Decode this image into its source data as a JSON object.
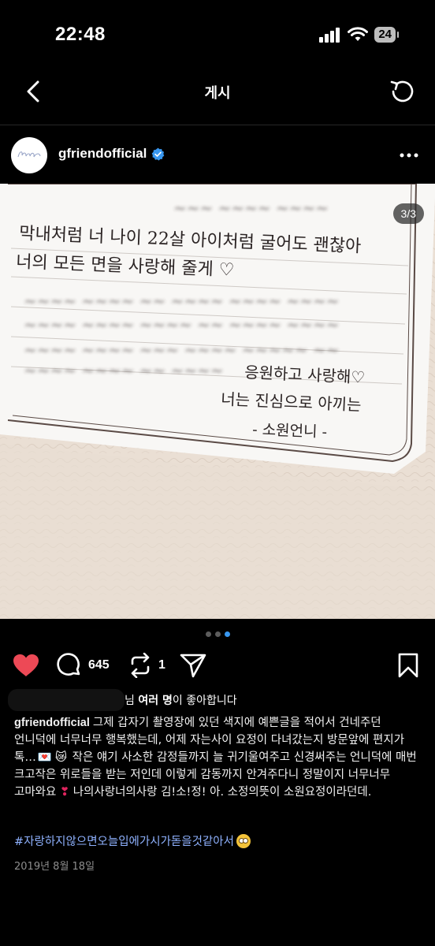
{
  "status": {
    "time": "22:48",
    "battery": "24"
  },
  "nav": {
    "title": "게시"
  },
  "post": {
    "username": "gfriendofficial",
    "image_counter": "3/3",
    "likes_suffix": "님 ",
    "likes_bold": "여러 명",
    "likes_tail": "이 좋아합니다",
    "comments": "645",
    "shares": "1",
    "caption_user": "gfriendofficial",
    "caption_text_1": "그제 갑자기 촬영장에 있던 색지에 예쁜글을 적어서 건네주던 언니덕에 너무너무 행복했는데, 어제 자는사이 요정이 다녀갔는지 방문앞에 편지가 톡…",
    "caption_text_2": " 작은 얘기 사소한 감정들까지 늘 귀기울여주고 신경써주는 언니덕에 매번 크고작은 위로들을 받는 저인데 이렇게 감동까지 안겨주다니 정말이지 너무너무 고마와요 ",
    "caption_text_3": " 나의사랑너의사랑 김!소!정! 아. 소정의뜻이 소원요정이라던데.",
    "hashtag": "#자랑하지않으면오늘입에가시가돋을것같아서",
    "date": "2019년 8월 18일"
  },
  "letter": {
    "lines": [
      "막내처럼 너 나이 22살 아이처럼 굴어도 괜찮아",
      "너의 모든 면을 사랑해 줄게 ♡",
      "응원하고 사랑해♡",
      "너는 진심으로 아끼는",
      "- 소원언니 -"
    ]
  },
  "colors": {
    "accent": "#3897f0",
    "heart": "#ed4956",
    "verified": "#3897f0"
  }
}
